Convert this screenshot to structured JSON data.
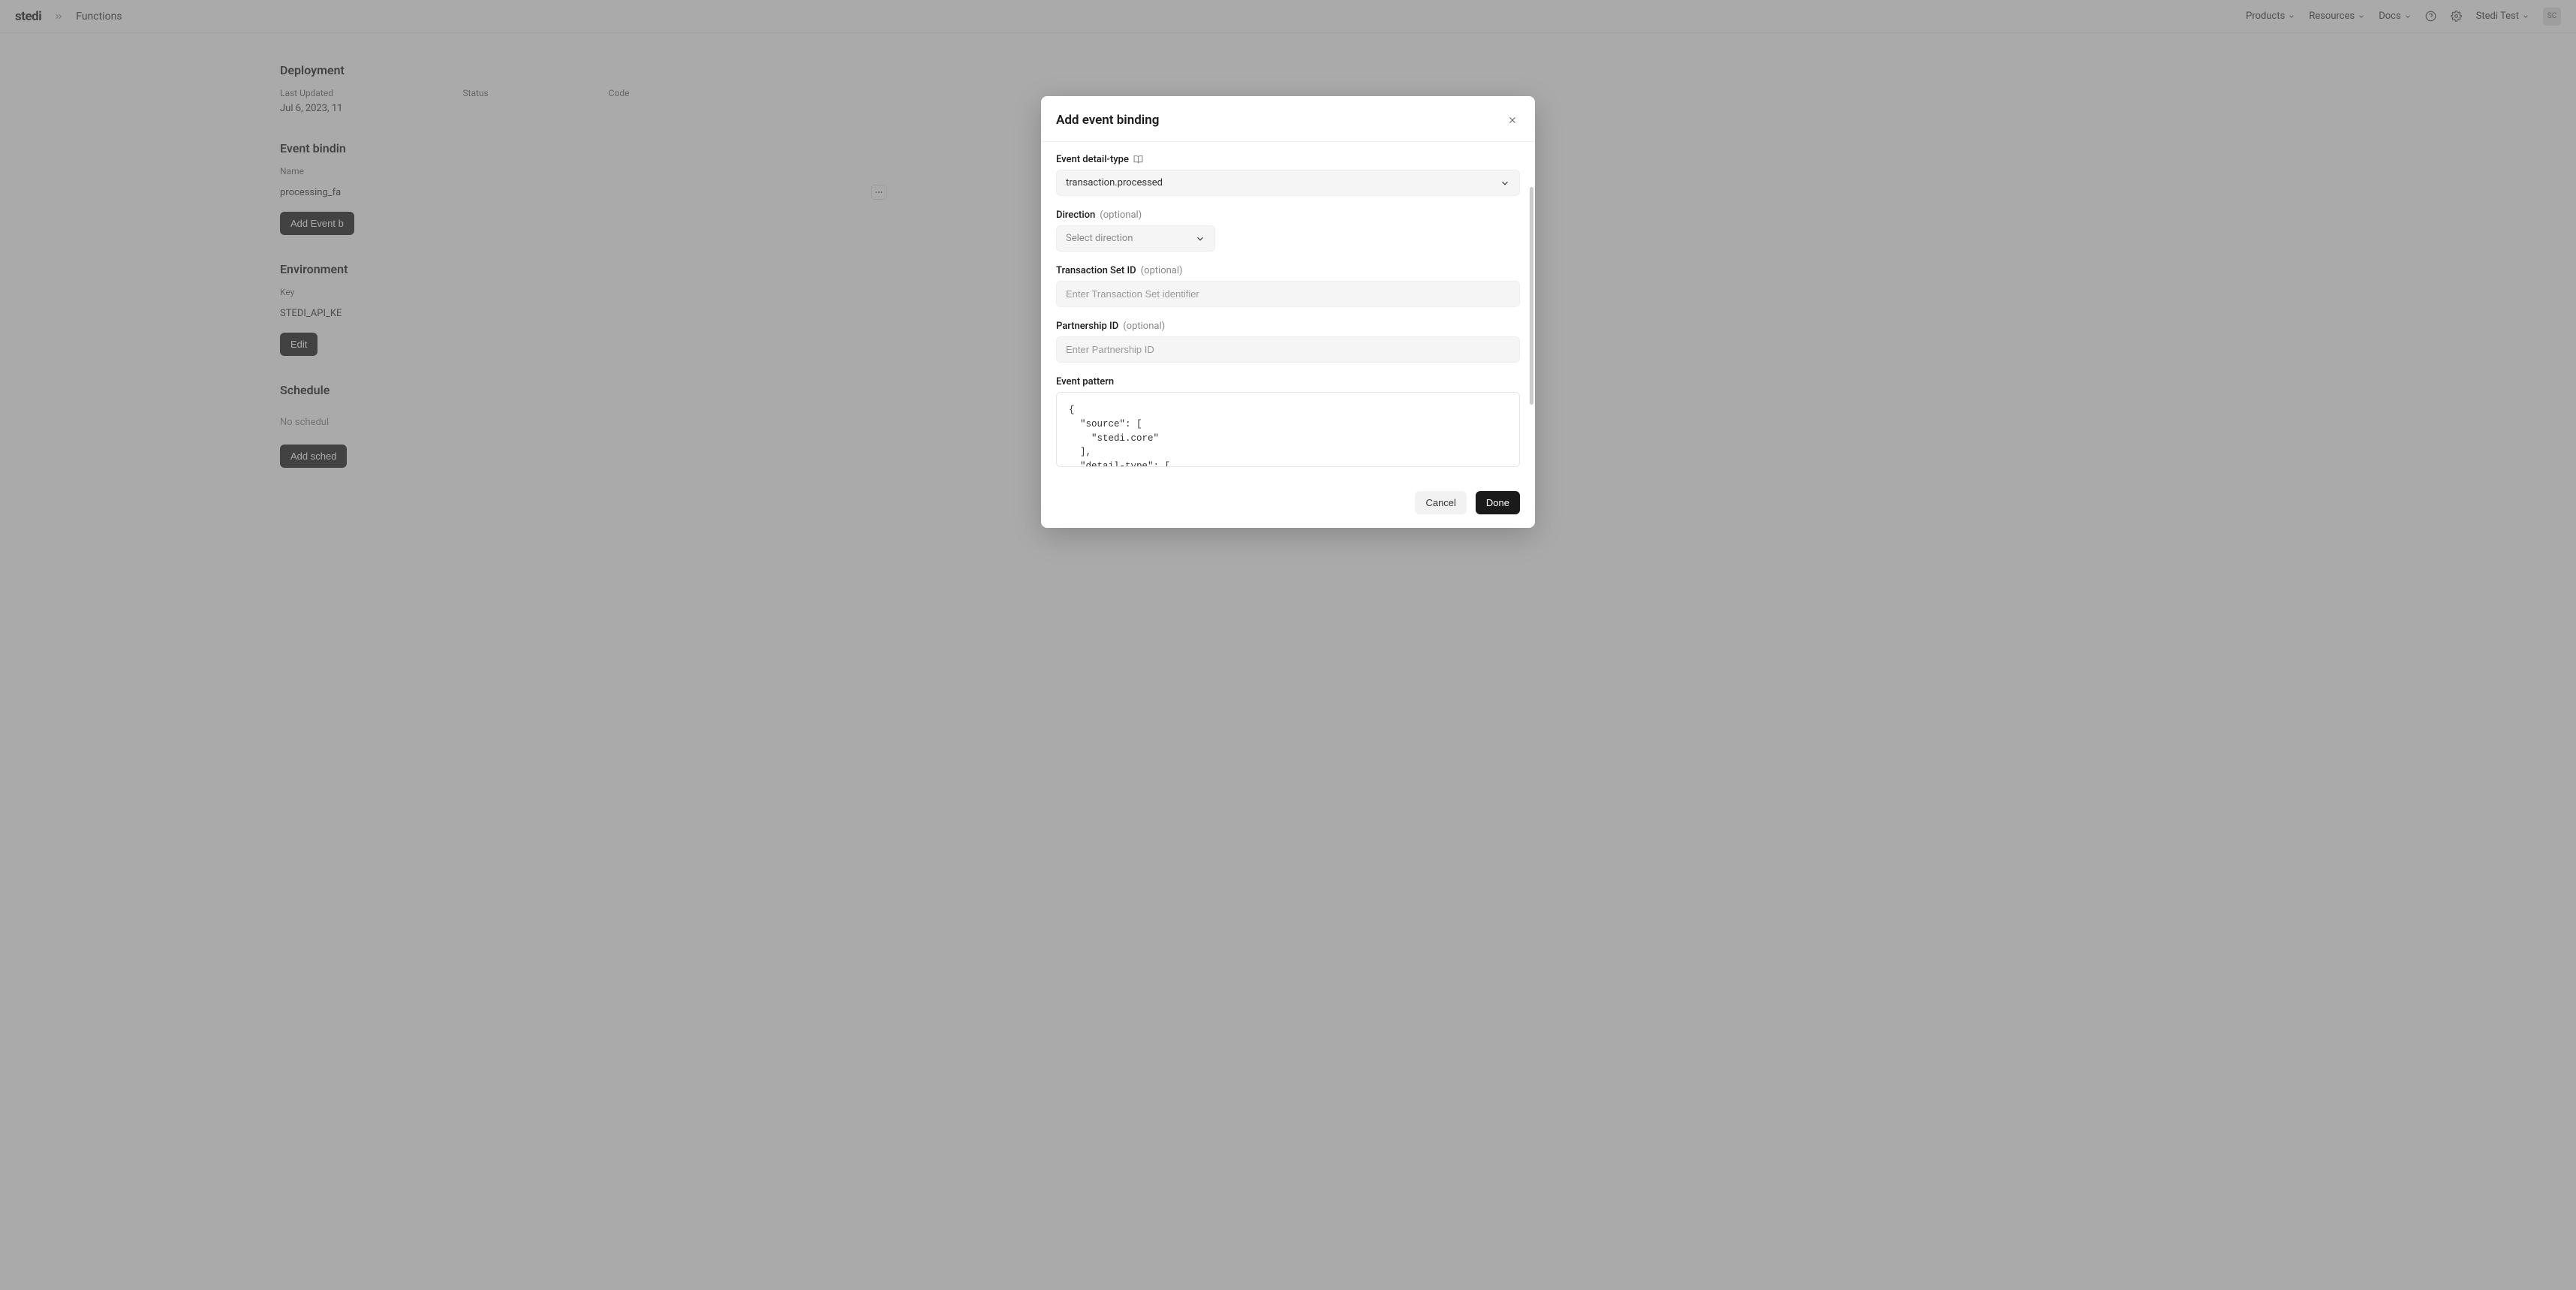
{
  "header": {
    "logo": "stedi",
    "breadcrumb": "Functions",
    "nav": {
      "products": "Products",
      "resources": "Resources",
      "docs": "Docs",
      "account": "Stedi Test",
      "avatar_initials": "SC"
    }
  },
  "page": {
    "deployment": {
      "title": "Deployment",
      "last_updated_label": "Last Updated",
      "last_updated_value": "Jul 6, 2023, 11",
      "status_label": "Status",
      "code_label": "Code"
    },
    "event_bindings": {
      "title": "Event bindin",
      "name_label": "Name",
      "name_value": "processing_fa",
      "add_button": "Add Event b"
    },
    "environment": {
      "title": "Environment",
      "key_label": "Key",
      "key_value": "STEDI_API_KE",
      "edit_button": "Edit"
    },
    "schedule": {
      "title": "Schedule",
      "empty_text": "No schedul",
      "add_button": "Add sched"
    }
  },
  "modal": {
    "title": "Add event binding",
    "event_detail_type": {
      "label": "Event detail-type",
      "value": "transaction.processed"
    },
    "direction": {
      "label": "Direction",
      "optional": "(optional)",
      "placeholder": "Select direction"
    },
    "transaction_set_id": {
      "label": "Transaction Set ID",
      "optional": "(optional)",
      "placeholder": "Enter Transaction Set identifier"
    },
    "partnership_id": {
      "label": "Partnership ID",
      "optional": "(optional)",
      "placeholder": "Enter Partnership ID"
    },
    "event_pattern": {
      "label": "Event pattern",
      "code": "{\n  \"source\": [\n    \"stedi.core\"\n  ],\n  \"detail-type\": ["
    },
    "footer": {
      "cancel": "Cancel",
      "done": "Done"
    }
  }
}
